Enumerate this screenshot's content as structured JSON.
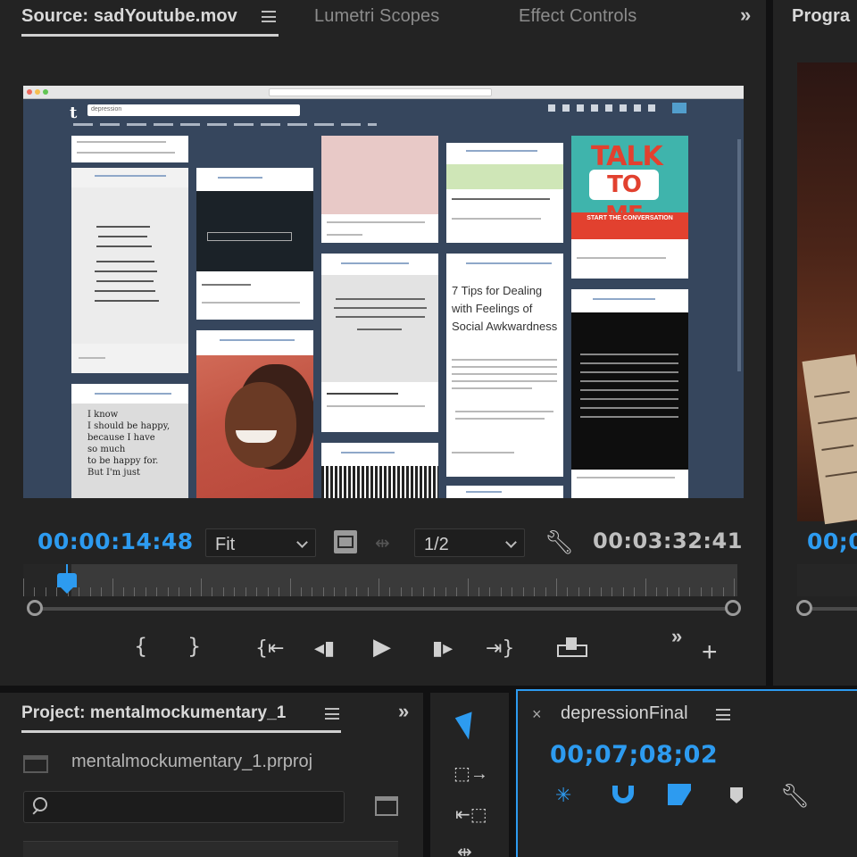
{
  "source_panel": {
    "tabs": [
      {
        "label": "Source: sadYoutube.mov",
        "active": true
      },
      {
        "label": "Lumetri Scopes",
        "active": false
      },
      {
        "label": "Effect Controls",
        "active": false
      }
    ],
    "current_time": "00:00:14:48",
    "zoom_value": "Fit",
    "resolution_value": "1/2",
    "duration": "00:03:32:41",
    "playhead_fraction": 0.061
  },
  "program_panel": {
    "tab_label": "Progra",
    "timecode_partial": "00;0"
  },
  "project_panel": {
    "tab_label": "Project: mentalmockumentary_1",
    "project_file": "mentalmockumentary_1.prproj"
  },
  "timeline_panel": {
    "sequence_name": "depressionFinal",
    "timecode": "00;07;08;02"
  },
  "browser_content": {
    "search_placeholder": "depression",
    "talk_card": {
      "line1": "TALK",
      "line2": "TO ME",
      "banner": "START THE CONVERSATION"
    },
    "article_title": "7 Tips for Dealing with Feelings of Social Awkwardness",
    "quote_lines": [
      "I know",
      "I should be happy,",
      "because I have",
      "so much",
      "to be happy for.",
      "But I'm just"
    ]
  },
  "colors": {
    "accent_blue": "#2d9bf0",
    "panel_bg": "#232323",
    "tumblr_navy": "#36465d",
    "talk_red": "#e2412f",
    "talk_teal": "#3fb4ac"
  }
}
